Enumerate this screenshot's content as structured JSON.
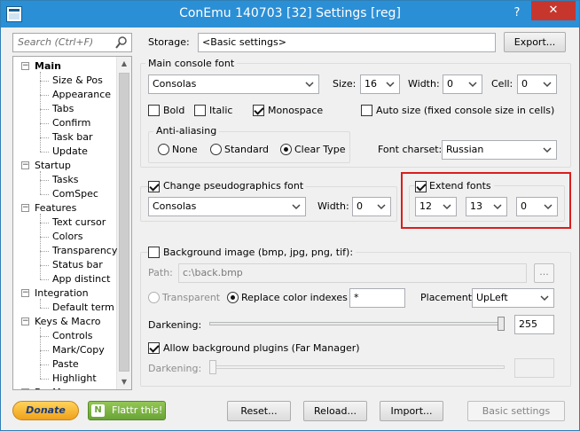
{
  "window": {
    "title": "ConEmu 140703 [32] Settings [reg]",
    "help_label": "?",
    "close_label": "✕"
  },
  "search": {
    "placeholder": "Search (Ctrl+F)"
  },
  "tree": {
    "items": [
      {
        "label": "Main",
        "level": 0,
        "selected": true
      },
      {
        "label": "Size & Pos",
        "level": 1
      },
      {
        "label": "Appearance",
        "level": 1
      },
      {
        "label": "Tabs",
        "level": 1
      },
      {
        "label": "Confirm",
        "level": 1
      },
      {
        "label": "Task bar",
        "level": 1
      },
      {
        "label": "Update",
        "level": 1
      },
      {
        "label": "Startup",
        "level": 0
      },
      {
        "label": "Tasks",
        "level": 1
      },
      {
        "label": "ComSpec",
        "level": 1
      },
      {
        "label": "Features",
        "level": 0
      },
      {
        "label": "Text cursor",
        "level": 1
      },
      {
        "label": "Colors",
        "level": 1
      },
      {
        "label": "Transparency",
        "level": 1
      },
      {
        "label": "Status bar",
        "level": 1
      },
      {
        "label": "App distinct",
        "level": 1
      },
      {
        "label": "Integration",
        "level": 0
      },
      {
        "label": "Default term",
        "level": 1
      },
      {
        "label": "Keys & Macro",
        "level": 0
      },
      {
        "label": "Controls",
        "level": 1
      },
      {
        "label": "Mark/Copy",
        "level": 1
      },
      {
        "label": "Paste",
        "level": 1
      },
      {
        "label": "Highlight",
        "level": 1
      },
      {
        "label": "Far Manager",
        "level": 0
      }
    ]
  },
  "storage": {
    "label": "Storage:",
    "value": "<Basic settings>",
    "export_label": "Export..."
  },
  "main_font": {
    "group_title": "Main console font",
    "font": "Consolas",
    "size_label": "Size:",
    "size": "16",
    "width_label": "Width:",
    "width": "0",
    "cell_label": "Cell:",
    "cell": "0",
    "bold_label": "Bold",
    "italic_label": "Italic",
    "monospace_label": "Monospace",
    "autosize_label": "Auto size (fixed console size in cells)",
    "antialias_title": "Anti-aliasing",
    "none_label": "None",
    "standard_label": "Standard",
    "cleartype_label": "Clear Type",
    "charset_label": "Font charset:",
    "charset": "Russian"
  },
  "pseudo": {
    "check_label": "Change pseudographics font",
    "font": "Consolas",
    "width_label": "Width:",
    "width": "0"
  },
  "extend": {
    "check_label": "Extend fonts",
    "val1": "12",
    "val2": "13",
    "val3": "0"
  },
  "background": {
    "check_label": "Background image (bmp, jpg, png, tif):",
    "path_label": "Path:",
    "path_value": "c:\\back.bmp",
    "browse_label": "...",
    "transparent_label": "Transparent",
    "replace_label": "Replace color indexes",
    "replace_value": "*",
    "placement_label": "Placement:",
    "placement": "UpLeft",
    "darkening_label": "Darkening:",
    "darkening_value": "255",
    "plugins_label": "Allow background plugins (Far Manager)",
    "darkening2_label": "Darkening:"
  },
  "footer": {
    "donate_label": "Donate",
    "flattr_label": "Flattr this!",
    "reset_label": "Reset...",
    "reload_label": "Reload...",
    "import_label": "Import...",
    "basic_label": "Basic settings"
  },
  "colors": {
    "title_bar": "#2b8fd6",
    "close_button": "#c7362d",
    "highlight_box": "#d91e1e",
    "donate": "#f5a623"
  }
}
